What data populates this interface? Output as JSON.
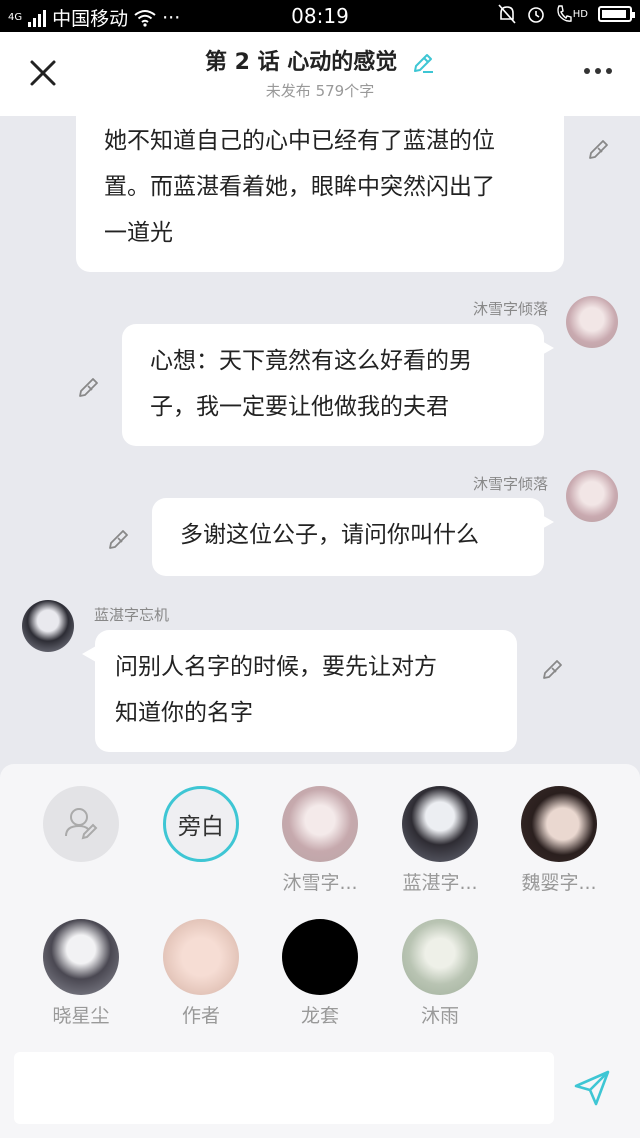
{
  "status_bar": {
    "network": "4G",
    "carrier": "中国移动",
    "dots": "···",
    "time": "08:19",
    "hd": "HD"
  },
  "header": {
    "title": "第 2 话 心动的感觉",
    "subtitle": "未发布 579个字"
  },
  "messages": [
    {
      "side": "left",
      "speaker": "",
      "text_lines": [
        "她不知道自己的心中已经有了蓝湛的位",
        "置。而蓝湛看着她，眼眸中突然闪出了",
        "一道光"
      ]
    },
    {
      "side": "right",
      "speaker": "沐雪字倾落",
      "text_lines": [
        "心想：天下竟然有这么好看的男",
        "子，我一定要让他做我的夫君"
      ]
    },
    {
      "side": "right",
      "speaker": "沐雪字倾落",
      "text_lines": [
        "多谢这位公子，请问你叫什么"
      ]
    },
    {
      "side": "left",
      "speaker": "蓝湛字忘机",
      "text_lines": [
        "问别人名字的时候，要先让对方",
        "知道你的名字"
      ]
    }
  ],
  "characters_row1": [
    {
      "label": "",
      "type": "add"
    },
    {
      "label": "旁白",
      "type": "narrator"
    },
    {
      "label": "沐雪字...",
      "type": "photo",
      "color": "#b9a4a6"
    },
    {
      "label": "蓝湛字...",
      "type": "photo",
      "color": "#6c6f7c"
    },
    {
      "label": "魏婴字...",
      "type": "photo",
      "color": "#3a2c2a"
    }
  ],
  "characters_row2": [
    {
      "label": "晓星尘",
      "type": "photo",
      "color": "#8e8f99"
    },
    {
      "label": "作者",
      "type": "photo",
      "color": "#e6c8bd"
    },
    {
      "label": "龙套",
      "type": "photo",
      "color": "#000000"
    },
    {
      "label": "沐雨",
      "type": "photo",
      "color": "#9fae9a"
    }
  ],
  "input": {
    "placeholder": ""
  },
  "colors": {
    "accent": "#3ec6d4",
    "background": "#e8e9ee"
  }
}
